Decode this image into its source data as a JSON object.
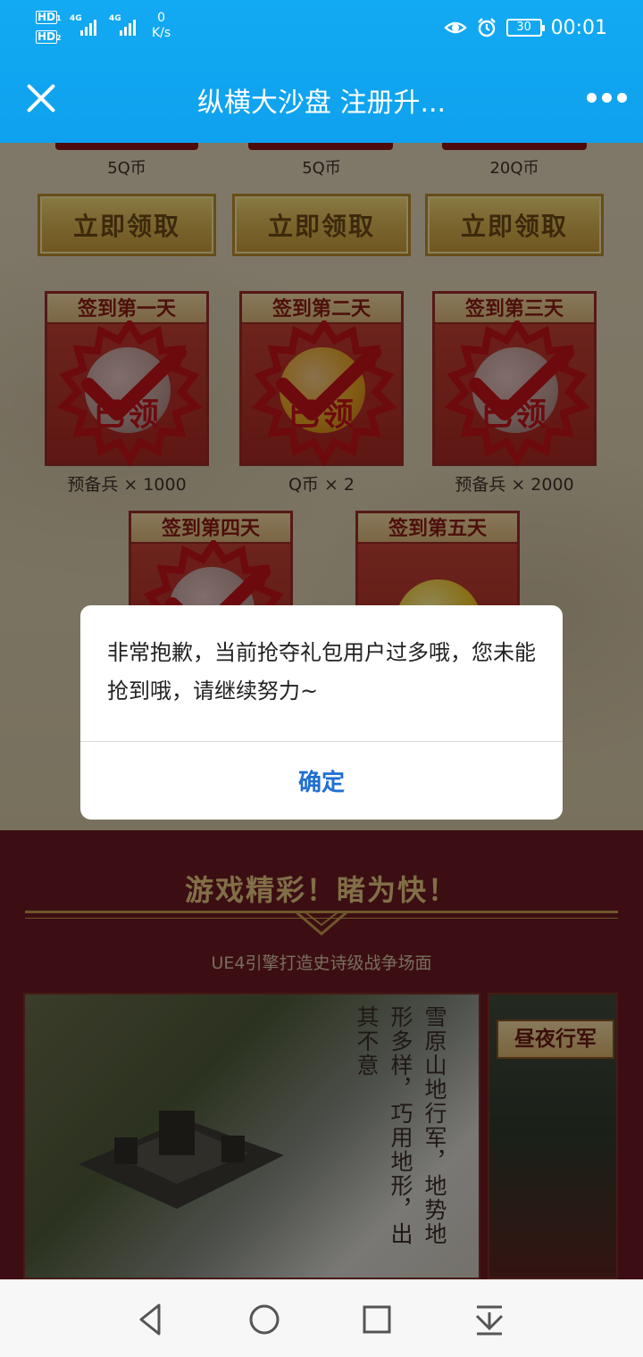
{
  "status_bar": {
    "sim1_label": "HD",
    "sim1_index": "1",
    "sim2_label": "HD",
    "sim2_index": "2",
    "network1": "4G",
    "network2": "4G",
    "speed_value": "0",
    "speed_unit": "K/s",
    "battery": "30",
    "time": "00:01"
  },
  "title_bar": {
    "title": "纵横大沙盘 注册升..."
  },
  "rewards": {
    "coins": [
      "5Q币",
      "5Q币",
      "20Q币"
    ],
    "claim_buttons": [
      "立即领取",
      "立即领取",
      "立即领取"
    ]
  },
  "checkin": {
    "days": [
      {
        "title": "签到第一天",
        "stamp": "已领",
        "reward": "预备兵 × 1000"
      },
      {
        "title": "签到第二天",
        "stamp": "已领",
        "reward": "Q币 × 2"
      },
      {
        "title": "签到第三天",
        "stamp": "已领",
        "reward": "预备兵 × 2000"
      },
      {
        "title": "签到第四天"
      },
      {
        "title": "签到第五天"
      }
    ]
  },
  "promo": {
    "title": "游戏精彩！睹为快！",
    "subtitle": "UE4引擎打造史诗级战争场面",
    "caption_col1": "雪原山地行军，地势地",
    "caption_col2": "形多样，巧用地形，出",
    "caption_col3": "其不意",
    "side_tag": "昼夜行军"
  },
  "dialog": {
    "message": "非常抱歉，当前抢夺礼包用户过多哦，您未能抢到哦，请继续努力~",
    "ok_label": "确定"
  },
  "colors": {
    "title_bar_bg": "#12aaf2",
    "dialog_button": "#1f6fd0",
    "promo_bg": "#6c1a23",
    "stamp_red": "#c2121a"
  },
  "icons": {
    "close": "close-icon",
    "more": "more-icon",
    "back": "back-icon",
    "home": "home-icon",
    "recents": "recents-icon",
    "notification": "notification-pull-icon",
    "eye": "eye-comfort-icon",
    "alarm": "alarm-icon"
  }
}
